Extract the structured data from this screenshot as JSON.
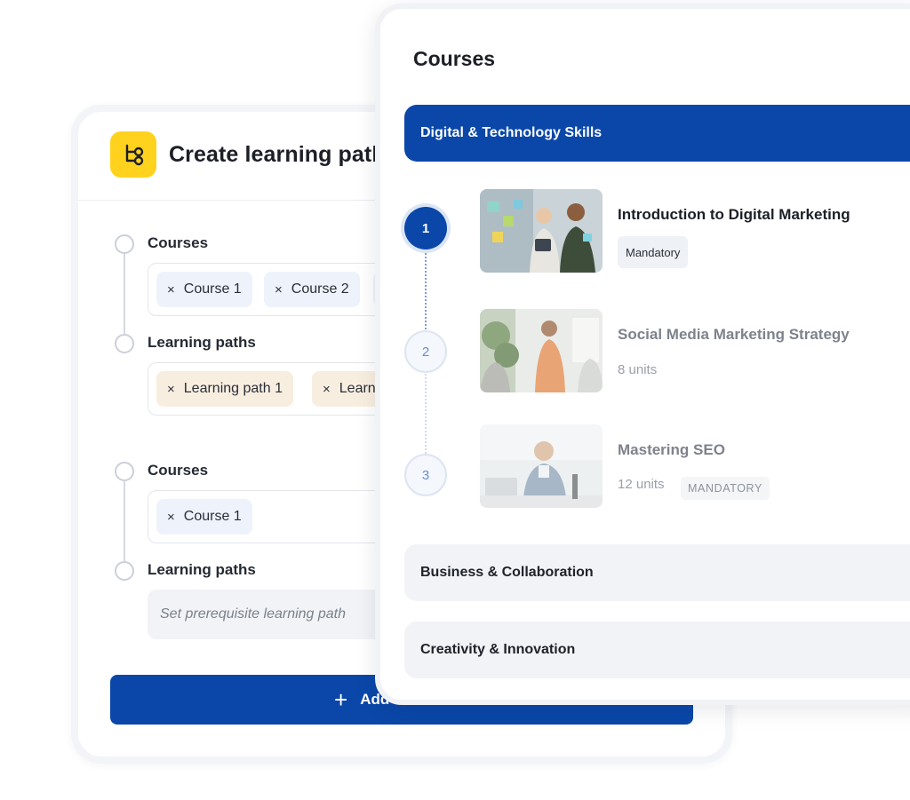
{
  "create_panel": {
    "title": "Create learning path",
    "app_icon": "path-tree-icon",
    "group1": {
      "courses_label": "Courses",
      "courses_chips": [
        "Course 1",
        "Course 2"
      ],
      "paths_label": "Learning paths",
      "paths_chips": [
        "Learning path 1",
        "Learnin"
      ]
    },
    "group2": {
      "courses_label": "Courses",
      "courses_chips": [
        "Course 1"
      ],
      "paths_label": "Learning paths",
      "paths_placeholder": "Set prerequisite learning path"
    },
    "add_button_label": "Add alternative",
    "chip_remove_symbol": "×"
  },
  "courses_panel": {
    "title": "Courses",
    "categories": [
      "Digital & Technology Skills",
      "Business & Collaboration",
      "Creativity & Innovation"
    ],
    "items": [
      {
        "step": "1",
        "title": "Introduction to Digital Marketing",
        "badge": "Mandatory"
      },
      {
        "step": "2",
        "title": "Social Media Marketing Strategy",
        "units": "8 units"
      },
      {
        "step": "3",
        "title": "Mastering SEO",
        "units": "12 units",
        "badge": "MANDATORY"
      }
    ]
  },
  "colors": {
    "primary": "#0a47a8",
    "icon_yellow": "#ffd21e",
    "course_chip": "#eef3fb",
    "path_chip": "#f8eee0"
  }
}
